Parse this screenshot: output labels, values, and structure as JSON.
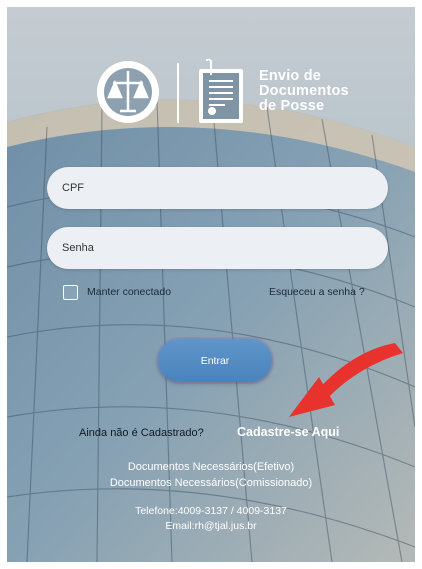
{
  "brand": {
    "line1": "Envio de",
    "line2": "Documentos",
    "line3": "de Posse"
  },
  "form": {
    "cpf_placeholder": "CPF",
    "password_placeholder": "Senha",
    "keep_connected": "Manter conectado",
    "forgot_password": "Esqueceu a senha ?",
    "submit": "Entrar"
  },
  "signup": {
    "question": "Ainda não é Cadastrado?",
    "link": "Cadastre-se Aqui"
  },
  "docs": {
    "effective": "Documentos Necessários(Efetivo)",
    "commissioned": "Documentos Necessários(Comissionado)"
  },
  "contact": {
    "phone": "Telefone:4009-3137 / 4009-3137",
    "email": "Email:rh@tjal.jus.br"
  },
  "colors": {
    "button": "#4f89c2",
    "input_bg": "#eceff3",
    "arrow": "#e8322d"
  }
}
